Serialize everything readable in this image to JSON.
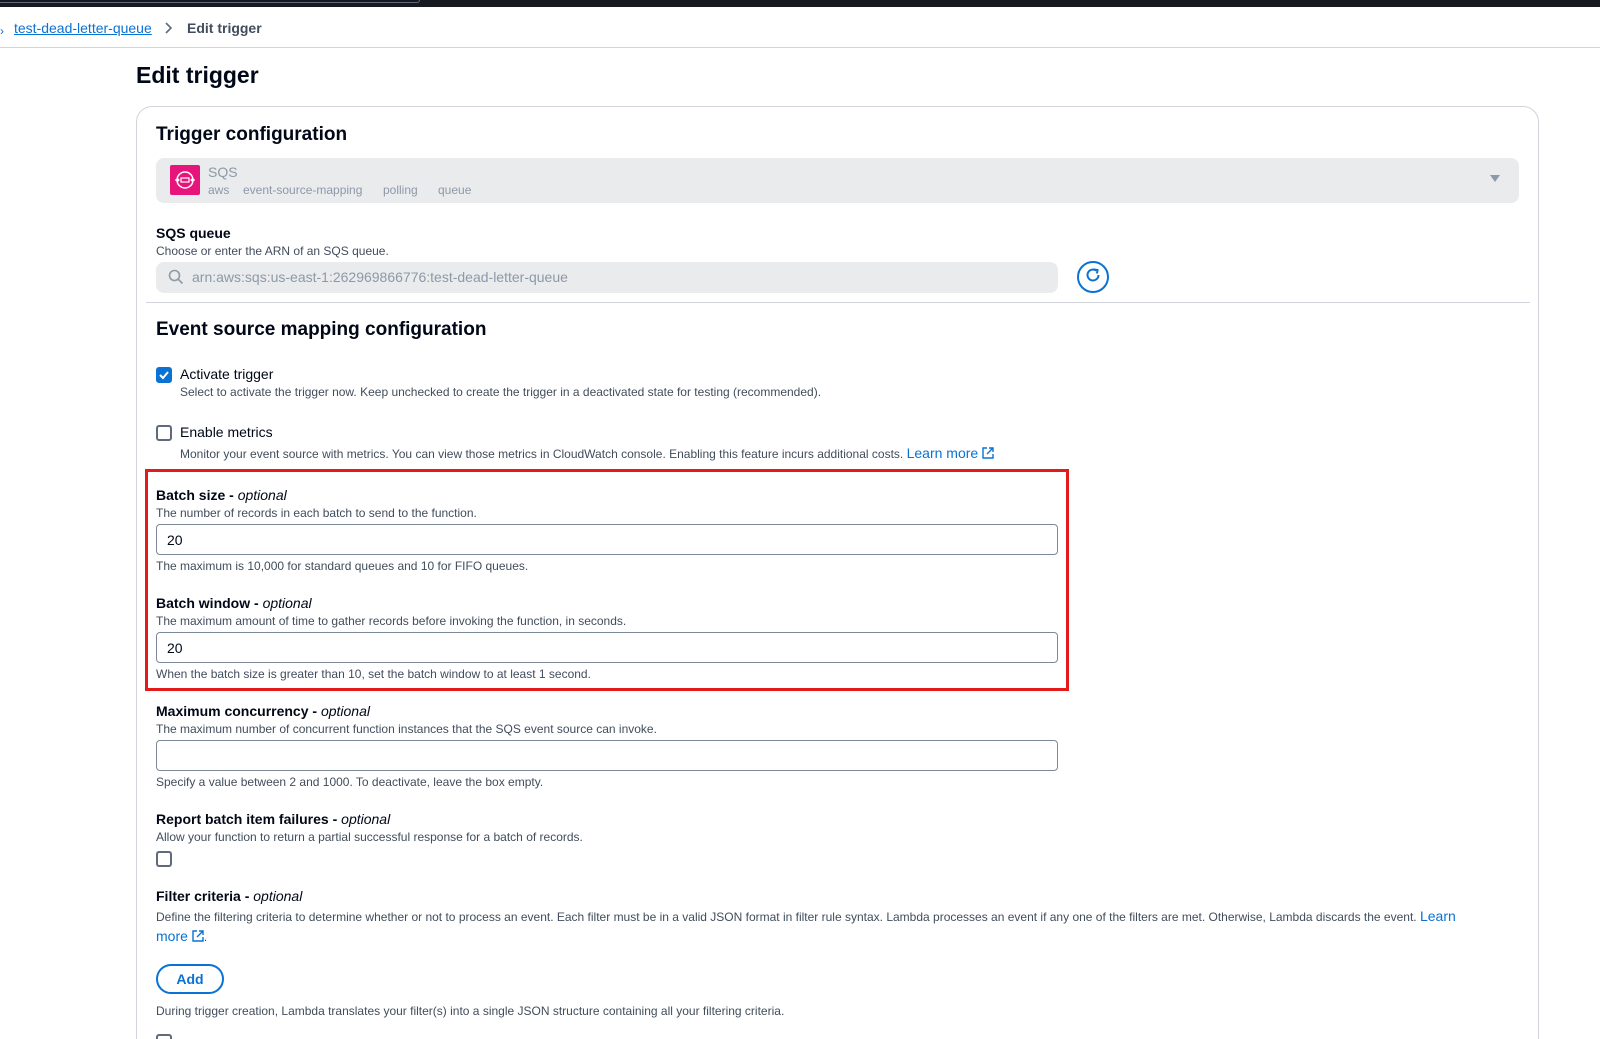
{
  "breadcrumb": {
    "caret": "›",
    "parent": "test-dead-letter-queue",
    "separator": ">",
    "current": "Edit trigger"
  },
  "page_title": "Edit trigger",
  "trigger_config": {
    "title": "Trigger configuration",
    "source": {
      "name": "SQS",
      "tags": [
        "aws",
        "event-source-mapping",
        "polling",
        "queue"
      ],
      "icon": "sqs-icon",
      "icon_color": "#e7157b"
    }
  },
  "sqs_queue": {
    "label": "SQS queue",
    "description": "Choose or enter the ARN of an SQS queue.",
    "value": "arn:aws:sqs:us-east-1:262969866776:test-dead-letter-queue"
  },
  "esm": {
    "title": "Event source mapping configuration",
    "activate": {
      "label": "Activate trigger",
      "description": "Select to activate the trigger now. Keep unchecked to create the trigger in a deactivated state for testing (recommended).",
      "checked": true
    },
    "metrics": {
      "label": "Enable metrics",
      "description": "Monitor your event source with metrics. You can view those metrics in CloudWatch console. Enabling this feature incurs additional costs.",
      "link": "Learn more",
      "checked": false
    },
    "batch_size": {
      "label": "Batch size -",
      "optional": "optional",
      "description": "The number of records in each batch to send to the function.",
      "value": "20",
      "hint": "The maximum is 10,000 for standard queues and 10 for FIFO queues."
    },
    "batch_window": {
      "label": "Batch window -",
      "optional": "optional",
      "description": "The maximum amount of time to gather records before invoking the function, in seconds.",
      "value": "20",
      "hint": "When the batch size is greater than 10, set the batch window to at least 1 second."
    },
    "max_concurrency": {
      "label": "Maximum concurrency -",
      "optional": "optional",
      "description": "The maximum number of concurrent function instances that the SQS event source can invoke.",
      "value": "",
      "hint": "Specify a value between 2 and 1000. To deactivate, leave the box empty."
    },
    "report_failures": {
      "label": "Report batch item failures -",
      "optional": "optional",
      "description": "Allow your function to return a partial successful response for a batch of records.",
      "checked": false
    },
    "filter": {
      "label": "Filter criteria -",
      "optional": "optional",
      "description": "Define the filtering criteria to determine whether or not to process an event. Each filter must be in a valid JSON format in filter rule syntax. Lambda processes an event if any one of the filters are met. Otherwise, Lambda discards the event.",
      "link_part1": "Learn",
      "link_part2": "more",
      "link_suffix": ".",
      "add_button": "Add",
      "footer": "During trigger creation, Lambda translates your filter(s) into a single JSON structure containing all your filtering criteria."
    }
  },
  "colors": {
    "accent": "#0972d3",
    "highlight": "#e31b1b"
  }
}
